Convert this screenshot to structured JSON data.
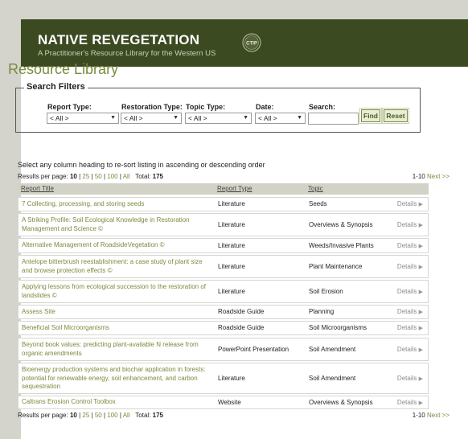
{
  "header": {
    "title": "NATIVE REVEGETATION",
    "subtitle": "A Practitioner's Resource Library for the Western US",
    "logo_text": "CTIP"
  },
  "page_title": "Resource Library",
  "search_filters": {
    "legend": "Search Filters",
    "report_type": {
      "label": "Report Type:",
      "value": "< All >"
    },
    "restoration_type": {
      "label": "Restoration Type:",
      "value": "< All >"
    },
    "topic_type": {
      "label": "Topic Type:",
      "value": "< All >"
    },
    "date": {
      "label": "Date:",
      "value": "< All >"
    },
    "search": {
      "label": "Search:",
      "value": ""
    },
    "find_label": "Find",
    "reset_label": "Reset"
  },
  "hint_text": "Select any column heading to re-sort listing in ascending or descending order",
  "results_top": {
    "prefix": "Results per page:",
    "current": "10",
    "options": [
      "25",
      "50",
      "100",
      "All"
    ],
    "total_label": "Total:",
    "total": "175",
    "range": "1-10",
    "next_label": "Next >>"
  },
  "results_bottom": {
    "prefix": "Results per page:",
    "current": "10",
    "options": [
      "25",
      "50",
      "100",
      "All"
    ],
    "total_label": "Total:",
    "total": "175",
    "range": "1-10",
    "next_label": "Next >>"
  },
  "table": {
    "columns": [
      "Report Title",
      "Report Type",
      "Topic"
    ],
    "details_label": "Details",
    "rows": [
      {
        "title": "7 Collecting, processing, and storing seeds",
        "type": "Literature",
        "topic": "Seeds"
      },
      {
        "title": "A Striking Profile: Soil Ecological Knowledge in Restoration Management and Science ©",
        "type": "Literature",
        "topic": "Overviews & Synopsis"
      },
      {
        "title": "Alternative Management of RoadsideVegetation ©",
        "type": "Literature",
        "topic": "Weeds/Invasive Plants"
      },
      {
        "title": "Antelope bitterbrush reestablishment: a case study of plant size and browse protection effects ©",
        "type": "Literature",
        "topic": "Plant Maintenance"
      },
      {
        "title": "Applying lessons from ecological succession to the restoration of landslides ©",
        "type": "Literature",
        "topic": "Soil Erosion"
      },
      {
        "title": "Assess Site",
        "type": "Roadside Guide",
        "topic": "Planning"
      },
      {
        "title": "Beneficial Soil Microorganisms",
        "type": "Roadside Guide",
        "topic": "Soil Microorganisms"
      },
      {
        "title": "Beyond book values: predicting plant-available N release from organic amendments",
        "type": "PowerPoint Presentation",
        "topic": "Soil Amendment"
      },
      {
        "title": "Bioenergy production systems and biochar application in forests: potential for renewable energy, soil enhancement, and carbon sequestration",
        "type": "Literature",
        "topic": "Soil Amendment"
      },
      {
        "title": "Caltrans Erosion Control Toolbox",
        "type": "Website",
        "topic": "Overviews & Synopsis"
      }
    ]
  },
  "colors": {
    "banner": "#3c4a22",
    "accent_green": "#7a8b3d",
    "header_row": "#d2d2c6",
    "page_bg": "#d4d4cd"
  }
}
